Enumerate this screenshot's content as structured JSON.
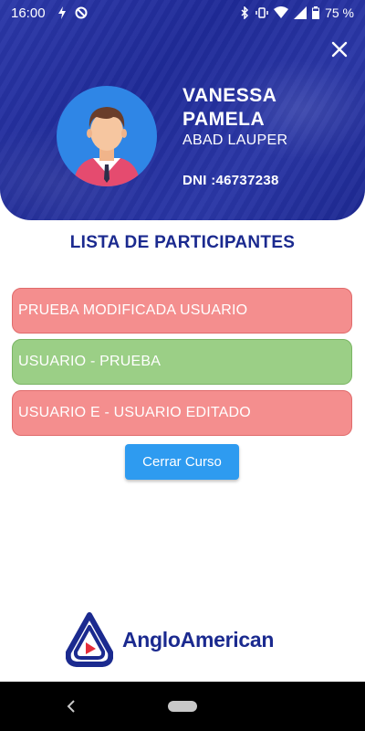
{
  "status_bar": {
    "time": "16:00",
    "battery": "75 %",
    "icons": [
      "flash-icon",
      "do-not-disturb-icon",
      "bluetooth-icon",
      "vibrate-icon",
      "wifi-icon",
      "signal-icon",
      "battery-icon"
    ]
  },
  "header": {
    "close_icon": "close-icon",
    "first_names": "VANESSA PAMELA",
    "last_names": "ABAD LAUPER",
    "dni": "DNI :46737238"
  },
  "list": {
    "title": "LISTA DE PARTICIPANTES",
    "participants": [
      {
        "name": "PRUEBA MODIFICADA USUARIO",
        "status_color": "#f48e8e"
      },
      {
        "name": "USUARIO - PRUEBA",
        "status_color": "#9bcf86"
      },
      {
        "name": "USUARIO E - USUARIO EDITADO",
        "status_color": "#f48e8e"
      }
    ]
  },
  "actions": {
    "close_course_label": "Cerrar Curso"
  },
  "logo": {
    "text": "AngloAmerican"
  },
  "colors": {
    "header_blue": "#2233a0",
    "title_blue": "#1b2a8f",
    "button_blue": "#2e9bf0",
    "absent_red": "#f48e8e",
    "present_green": "#9bcf86"
  }
}
